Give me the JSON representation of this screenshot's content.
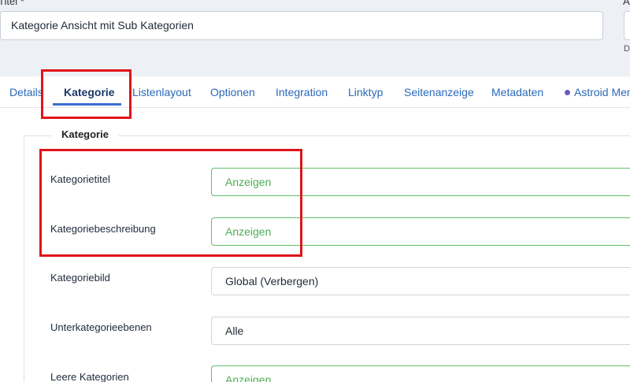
{
  "header": {
    "title_label": "Titel *",
    "title_value": "Kategorie Ansicht mit Sub Kategorien",
    "right_label": "A",
    "right_hint": "D"
  },
  "tabs": [
    {
      "label": "Details"
    },
    {
      "label": "Kategorie"
    },
    {
      "label": "Listenlayout"
    },
    {
      "label": "Optionen"
    },
    {
      "label": "Integration"
    },
    {
      "label": "Linktyp"
    },
    {
      "label": "Seitenanzeige"
    },
    {
      "label": "Metadaten"
    },
    {
      "label": "Astroid Menu"
    }
  ],
  "active_tab": "Kategorie",
  "fieldset": {
    "legend": "Kategorie",
    "rows": [
      {
        "label": "Kategorietitel",
        "value": "Anzeigen"
      },
      {
        "label": "Kategoriebeschreibung",
        "value": "Anzeigen"
      },
      {
        "label": "Kategoriebild",
        "value": "Global (Verbergen)"
      },
      {
        "label": "Unterkategorieebenen",
        "value": "Alle"
      },
      {
        "label": "Leere Kategorien",
        "value": "Anzeigen"
      }
    ]
  },
  "colors": {
    "highlight": "#e0141a",
    "shown_value": "#4cae56",
    "tab_link": "#2a69b8",
    "accent": "#3a6dd0"
  }
}
